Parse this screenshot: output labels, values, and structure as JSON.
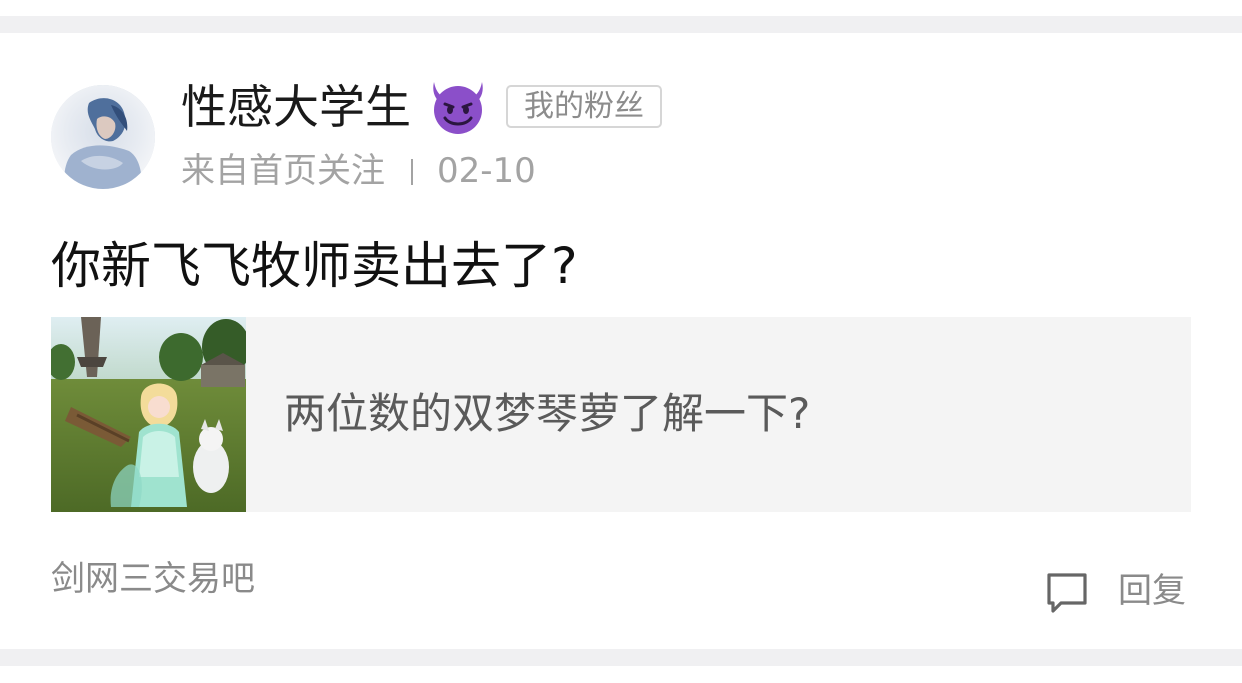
{
  "post": {
    "username": "性感大学生",
    "user_emoji": "smiling-devil-emoji",
    "fan_badge": "我的粉丝",
    "source": "来自首页关注",
    "date": "02-10",
    "title": "你新飞飞牧师卖出去了?",
    "quote": {
      "text": "两位数的双梦琴萝了解一下?"
    },
    "forum": "剑网三交易吧",
    "reply_label": "回复"
  },
  "colors": {
    "background": "#f0f0f2",
    "card": "#ffffff",
    "primary_text": "#1a1a1a",
    "secondary_text": "#a3a3a3",
    "quote_background": "#f4f4f4",
    "emoji_purple": "#8b4fc9"
  }
}
